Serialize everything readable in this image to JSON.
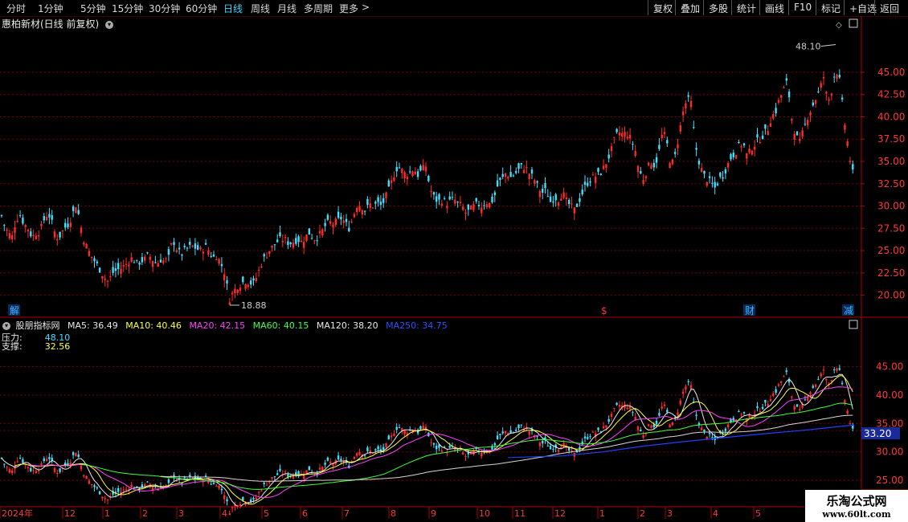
{
  "toolbar": {
    "periods": [
      "分时",
      "1分钟",
      "5分钟",
      "15分钟",
      "30分钟",
      "60分钟",
      "日线",
      "周线",
      "月线",
      "多周期",
      "更多"
    ],
    "active_period": "日线",
    "more_arrow": ">",
    "right_buttons": [
      "复权",
      "叠加",
      "多股",
      "统计",
      "画线",
      "F10",
      "标记",
      "+自选",
      "返回"
    ]
  },
  "main_chart": {
    "title": "惠柏新材(日线 前复权)",
    "high_label": "48.10",
    "low_label": "18.88",
    "y_ticks": [
      "45.00",
      "42.50",
      "40.00",
      "37.50",
      "35.00",
      "32.50",
      "30.00",
      "27.50",
      "25.00",
      "22.50",
      "20.00"
    ],
    "markers": [
      {
        "text": "解",
        "color": "#39b7ff"
      },
      {
        "text": "$",
        "color": "#ff3030"
      },
      {
        "text": "财",
        "color": "#39b7ff"
      },
      {
        "text": "减",
        "color": "#39b7ff"
      }
    ]
  },
  "indicator": {
    "name": "股朋指标网",
    "ma": [
      {
        "label": "MA5: 36.49",
        "color": "#e8e8e8"
      },
      {
        "label": "MA10: 40.46",
        "color": "#ffff40"
      },
      {
        "label": "MA20: 42.15",
        "color": "#ff40ff"
      },
      {
        "label": "MA60: 40.15",
        "color": "#40ff40"
      },
      {
        "label": "MA120: 38.20",
        "color": "#e8e8e8"
      },
      {
        "label": "MA250: 34.75",
        "color": "#3050ff"
      }
    ],
    "pressure_label": "压力:",
    "pressure_value": "48.10",
    "support_label": "支撑:",
    "support_value": "32.56",
    "y_ticks": [
      "45.00",
      "40.00",
      "35.00",
      "30.00",
      "25.00"
    ],
    "price_tag": "33.20"
  },
  "x_axis": {
    "labels": [
      "2024年",
      "12",
      "1",
      "2",
      "3",
      "4",
      "5",
      "6",
      "7",
      "8",
      "9",
      "10",
      "11",
      "12",
      "1",
      "2",
      "3",
      "4",
      "5"
    ]
  },
  "watermark": {
    "line1": "乐淘公式网",
    "line2": "www.60lt.com"
  },
  "colors": {
    "up": "#ff2a2a",
    "down": "#3fe0ff",
    "grid": "#7a0000",
    "axis": "#b00000"
  },
  "chart_data": {
    "type": "candlestick",
    "close_path": [
      [
        0,
        29.5
      ],
      [
        5,
        28
      ],
      [
        10,
        27
      ],
      [
        15,
        26.5
      ],
      [
        20,
        28.5
      ],
      [
        25,
        29
      ],
      [
        30,
        28
      ],
      [
        35,
        27.5
      ],
      [
        40,
        26.5
      ],
      [
        45,
        27
      ],
      [
        50,
        27.2
      ],
      [
        55,
        28.5
      ],
      [
        60,
        29.3
      ],
      [
        65,
        28
      ],
      [
        70,
        26.5
      ],
      [
        75,
        26.7
      ],
      [
        80,
        27.5
      ],
      [
        85,
        28
      ],
      [
        90,
        29
      ],
      [
        95,
        30.3
      ],
      [
        100,
        28
      ],
      [
        105,
        26
      ],
      [
        110,
        25
      ],
      [
        115,
        24.2
      ],
      [
        120,
        23.5
      ],
      [
        125,
        22.8
      ],
      [
        130,
        22
      ],
      [
        135,
        21.5
      ],
      [
        140,
        22.5
      ],
      [
        145,
        22.8
      ],
      [
        150,
        23
      ],
      [
        155,
        23.3
      ],
      [
        160,
        23.8
      ],
      [
        165,
        24.2
      ],
      [
        170,
        23.5
      ],
      [
        175,
        23.8
      ],
      [
        180,
        24
      ],
      [
        185,
        24.5
      ],
      [
        190,
        24
      ],
      [
        195,
        23.5
      ],
      [
        200,
        24
      ],
      [
        205,
        23.8
      ],
      [
        210,
        24.2
      ],
      [
        215,
        26.3
      ],
      [
        220,
        25.2
      ],
      [
        225,
        24.5
      ],
      [
        230,
        25
      ],
      [
        235,
        25.3
      ],
      [
        240,
        25.5
      ],
      [
        245,
        25.2
      ],
      [
        250,
        25
      ],
      [
        255,
        25.5
      ],
      [
        260,
        25
      ],
      [
        265,
        24.2
      ],
      [
        270,
        24.5
      ],
      [
        275,
        23.5
      ],
      [
        280,
        22.5
      ],
      [
        285,
        19.5
      ],
      [
        290,
        20.3
      ],
      [
        295,
        21
      ],
      [
        300,
        21.3
      ],
      [
        305,
        21.6
      ],
      [
        310,
        21.5
      ],
      [
        315,
        21.2
      ],
      [
        320,
        22.2
      ],
      [
        325,
        23.5
      ],
      [
        330,
        24.3
      ],
      [
        335,
        25
      ],
      [
        340,
        25.5
      ],
      [
        345,
        26
      ],
      [
        350,
        26.3
      ],
      [
        355,
        26.2
      ],
      [
        360,
        25.8
      ],
      [
        365,
        26
      ],
      [
        370,
        26.3
      ],
      [
        375,
        26
      ],
      [
        380,
        26.5
      ],
      [
        385,
        27
      ],
      [
        390,
        26.3
      ],
      [
        395,
        26.5
      ],
      [
        400,
        27
      ],
      [
        405,
        27.8
      ],
      [
        410,
        28.2
      ],
      [
        415,
        28
      ],
      [
        420,
        28.3
      ],
      [
        425,
        28.7
      ],
      [
        430,
        28
      ],
      [
        435,
        27.5
      ],
      [
        440,
        29
      ],
      [
        445,
        30.3
      ],
      [
        450,
        30
      ],
      [
        455,
        29.5
      ],
      [
        460,
        30.2
      ],
      [
        465,
        30
      ],
      [
        470,
        30.3
      ],
      [
        475,
        30
      ],
      [
        480,
        31
      ],
      [
        485,
        32
      ],
      [
        490,
        33.5
      ],
      [
        495,
        34.5
      ],
      [
        500,
        34
      ],
      [
        505,
        33.5
      ],
      [
        510,
        33.8
      ],
      [
        515,
        34.2
      ],
      [
        520,
        33.5
      ],
      [
        525,
        34
      ],
      [
        530,
        34.5
      ],
      [
        535,
        32
      ],
      [
        540,
        31
      ],
      [
        545,
        30.5
      ],
      [
        550,
        30.7
      ],
      [
        555,
        30.3
      ],
      [
        560,
        30.5
      ],
      [
        565,
        30.8
      ],
      [
        570,
        30.2
      ],
      [
        575,
        30
      ],
      [
        580,
        29.2
      ],
      [
        585,
        29.5
      ],
      [
        590,
        30
      ],
      [
        595,
        30.2
      ],
      [
        600,
        30
      ],
      [
        605,
        30.5
      ],
      [
        610,
        30.2
      ],
      [
        615,
        31
      ],
      [
        620,
        32.5
      ],
      [
        625,
        33
      ],
      [
        630,
        33.8
      ],
      [
        635,
        33.2
      ],
      [
        640,
        33.5
      ],
      [
        645,
        34
      ],
      [
        650,
        34.5
      ],
      [
        655,
        34.2
      ],
      [
        660,
        33.5
      ],
      [
        665,
        33
      ],
      [
        670,
        32
      ],
      [
        675,
        31.5
      ],
      [
        680,
        31.8
      ],
      [
        685,
        30.5
      ],
      [
        690,
        31
      ],
      [
        695,
        30.8
      ],
      [
        700,
        31.5
      ],
      [
        705,
        30.5
      ],
      [
        710,
        30
      ],
      [
        715,
        29.5
      ],
      [
        720,
        30.5
      ],
      [
        725,
        31.5
      ],
      [
        730,
        32.5
      ],
      [
        735,
        33
      ],
      [
        740,
        33.3
      ],
      [
        745,
        33.5
      ],
      [
        750,
        34
      ],
      [
        755,
        35
      ],
      [
        760,
        36
      ],
      [
        765,
        37.5
      ],
      [
        770,
        38.3
      ],
      [
        775,
        38
      ],
      [
        780,
        38.2
      ],
      [
        785,
        37.5
      ],
      [
        790,
        36.5
      ],
      [
        795,
        34
      ],
      [
        800,
        33
      ],
      [
        805,
        34
      ],
      [
        810,
        35
      ],
      [
        815,
        34.5
      ],
      [
        820,
        36
      ],
      [
        825,
        38.5
      ],
      [
        830,
        37
      ],
      [
        835,
        34.5
      ],
      [
        840,
        35.5
      ],
      [
        845,
        38
      ],
      [
        850,
        40.5
      ],
      [
        855,
        42
      ],
      [
        860,
        41.5
      ],
      [
        865,
        37
      ],
      [
        870,
        35
      ],
      [
        875,
        33.5
      ],
      [
        880,
        33
      ],
      [
        885,
        32.5
      ],
      [
        890,
        32
      ],
      [
        895,
        33
      ],
      [
        900,
        33.5
      ],
      [
        905,
        34.5
      ],
      [
        910,
        35.5
      ],
      [
        915,
        36
      ],
      [
        920,
        36.8
      ],
      [
        925,
        37
      ],
      [
        930,
        35.5
      ],
      [
        935,
        36.5
      ],
      [
        940,
        37
      ],
      [
        945,
        37.5
      ],
      [
        950,
        38
      ],
      [
        955,
        38.5
      ],
      [
        960,
        40
      ],
      [
        965,
        40.5
      ],
      [
        970,
        42
      ],
      [
        975,
        43
      ],
      [
        980,
        44
      ],
      [
        985,
        40
      ],
      [
        990,
        38
      ],
      [
        995,
        37
      ],
      [
        1000,
        38.5
      ],
      [
        1005,
        40
      ],
      [
        1010,
        41
      ],
      [
        1015,
        42
      ],
      [
        1020,
        43
      ],
      [
        1025,
        44.5
      ],
      [
        1030,
        41.5
      ],
      [
        1035,
        43
      ],
      [
        1040,
        45.5
      ],
      [
        1045,
        44
      ],
      [
        1050,
        40
      ],
      [
        1055,
        37
      ],
      [
        1060,
        34
      ],
      [
        1063,
        33.2
      ]
    ],
    "ma250_path": [
      [
        632,
        29.0
      ],
      [
        700,
        29.3
      ],
      [
        750,
        30.0
      ],
      [
        800,
        31.0
      ],
      [
        850,
        31.8
      ],
      [
        900,
        32.5
      ],
      [
        950,
        33.2
      ],
      [
        1000,
        33.8
      ],
      [
        1063,
        34.75
      ]
    ],
    "high": 48.1,
    "low": 18.88,
    "main_ylim": [
      17.8,
      49.5
    ],
    "indicator_ylim": [
      20.5,
      51.0
    ],
    "last_price": 33.2
  }
}
